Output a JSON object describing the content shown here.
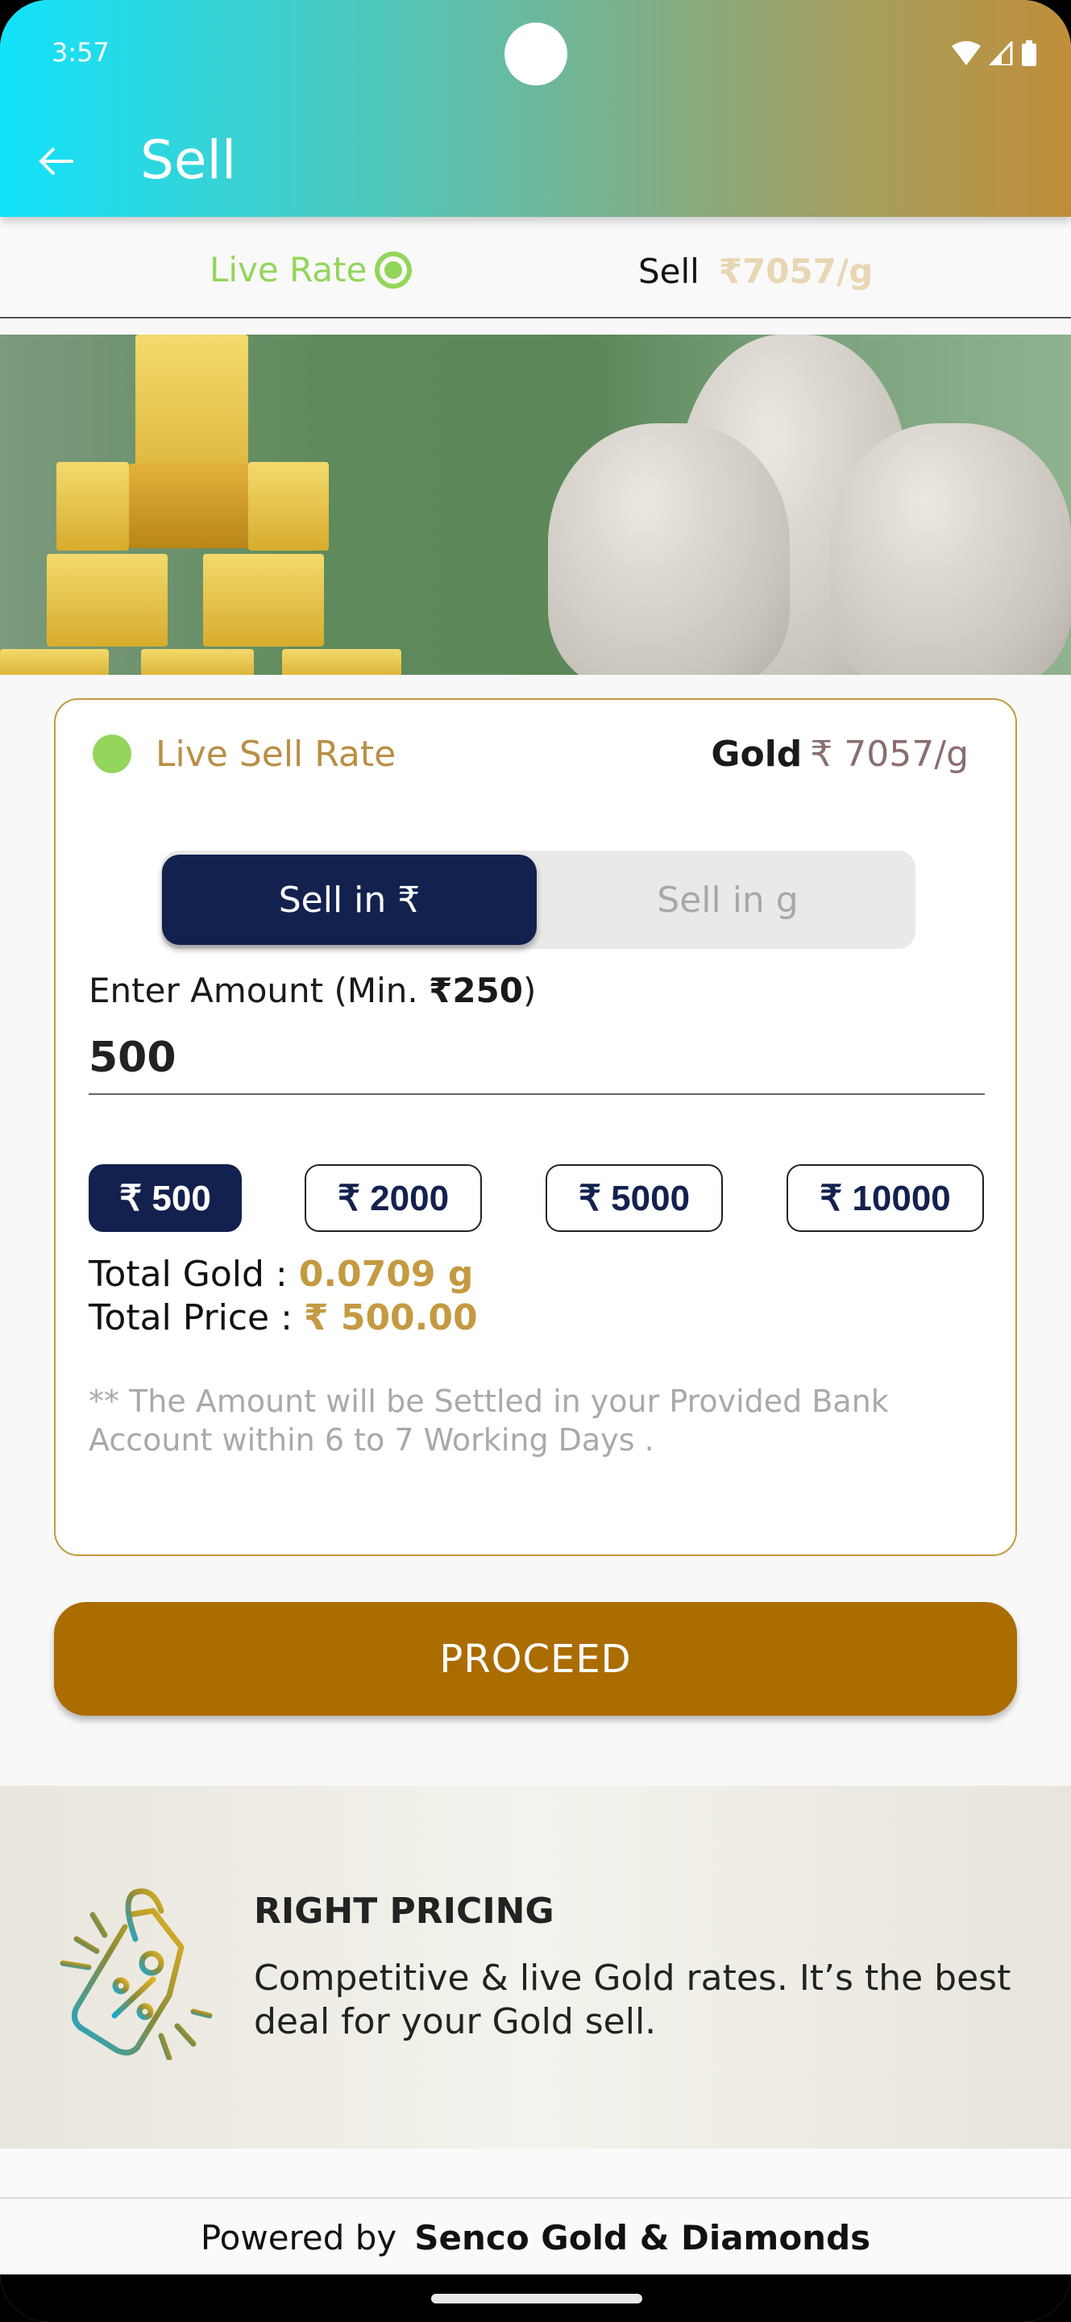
{
  "status_bar": {
    "time": "3:57",
    "icons": [
      "wifi-icon",
      "signal-icon",
      "battery-icon"
    ]
  },
  "app_bar": {
    "title": "Sell",
    "back_icon": "arrow-left-icon"
  },
  "rate_strip": {
    "live_label": "Live Rate",
    "sell_label": "Sell",
    "sell_value": "₹7057/g"
  },
  "card": {
    "live_label": "Live Sell Rate",
    "metal_label": "Gold",
    "metal_rate": "₹ 7057/g",
    "toggle": {
      "options": [
        "Sell in ₹",
        "Sell in g"
      ],
      "selected": 0
    },
    "amount_label_prefix": "Enter Amount (Min. ",
    "amount_label_min": "₹250",
    "amount_label_suffix": ")",
    "amount_value": "500",
    "chips": [
      {
        "label": "₹ 500",
        "active": true
      },
      {
        "label": "₹ 2000",
        "active": false
      },
      {
        "label": "₹ 5000",
        "active": false
      },
      {
        "label": "₹ 10000",
        "active": false
      }
    ],
    "total_gold_label": "Total Gold : ",
    "total_gold_value": "0.0709 g",
    "total_price_label": "Total Price : ",
    "total_price_value": "₹ 500.00",
    "note": "** The Amount will be Settled in your Provided Bank Account within 6 to 7 Working Days ."
  },
  "proceed_label": "PROCEED",
  "feature": {
    "title": "RIGHT PRICING",
    "description": "Competitive & live Gold rates. It’s the best deal for your Gold sell.",
    "icon": "price-tag-percent-icon"
  },
  "footer": {
    "powered_prefix": "Powered by",
    "brand": "Senco Gold & Diamonds"
  },
  "colors": {
    "accent_gold": "#c49a42",
    "navy": "#13214f",
    "live_green": "#93d65b",
    "proceed": "#ab6c00"
  }
}
